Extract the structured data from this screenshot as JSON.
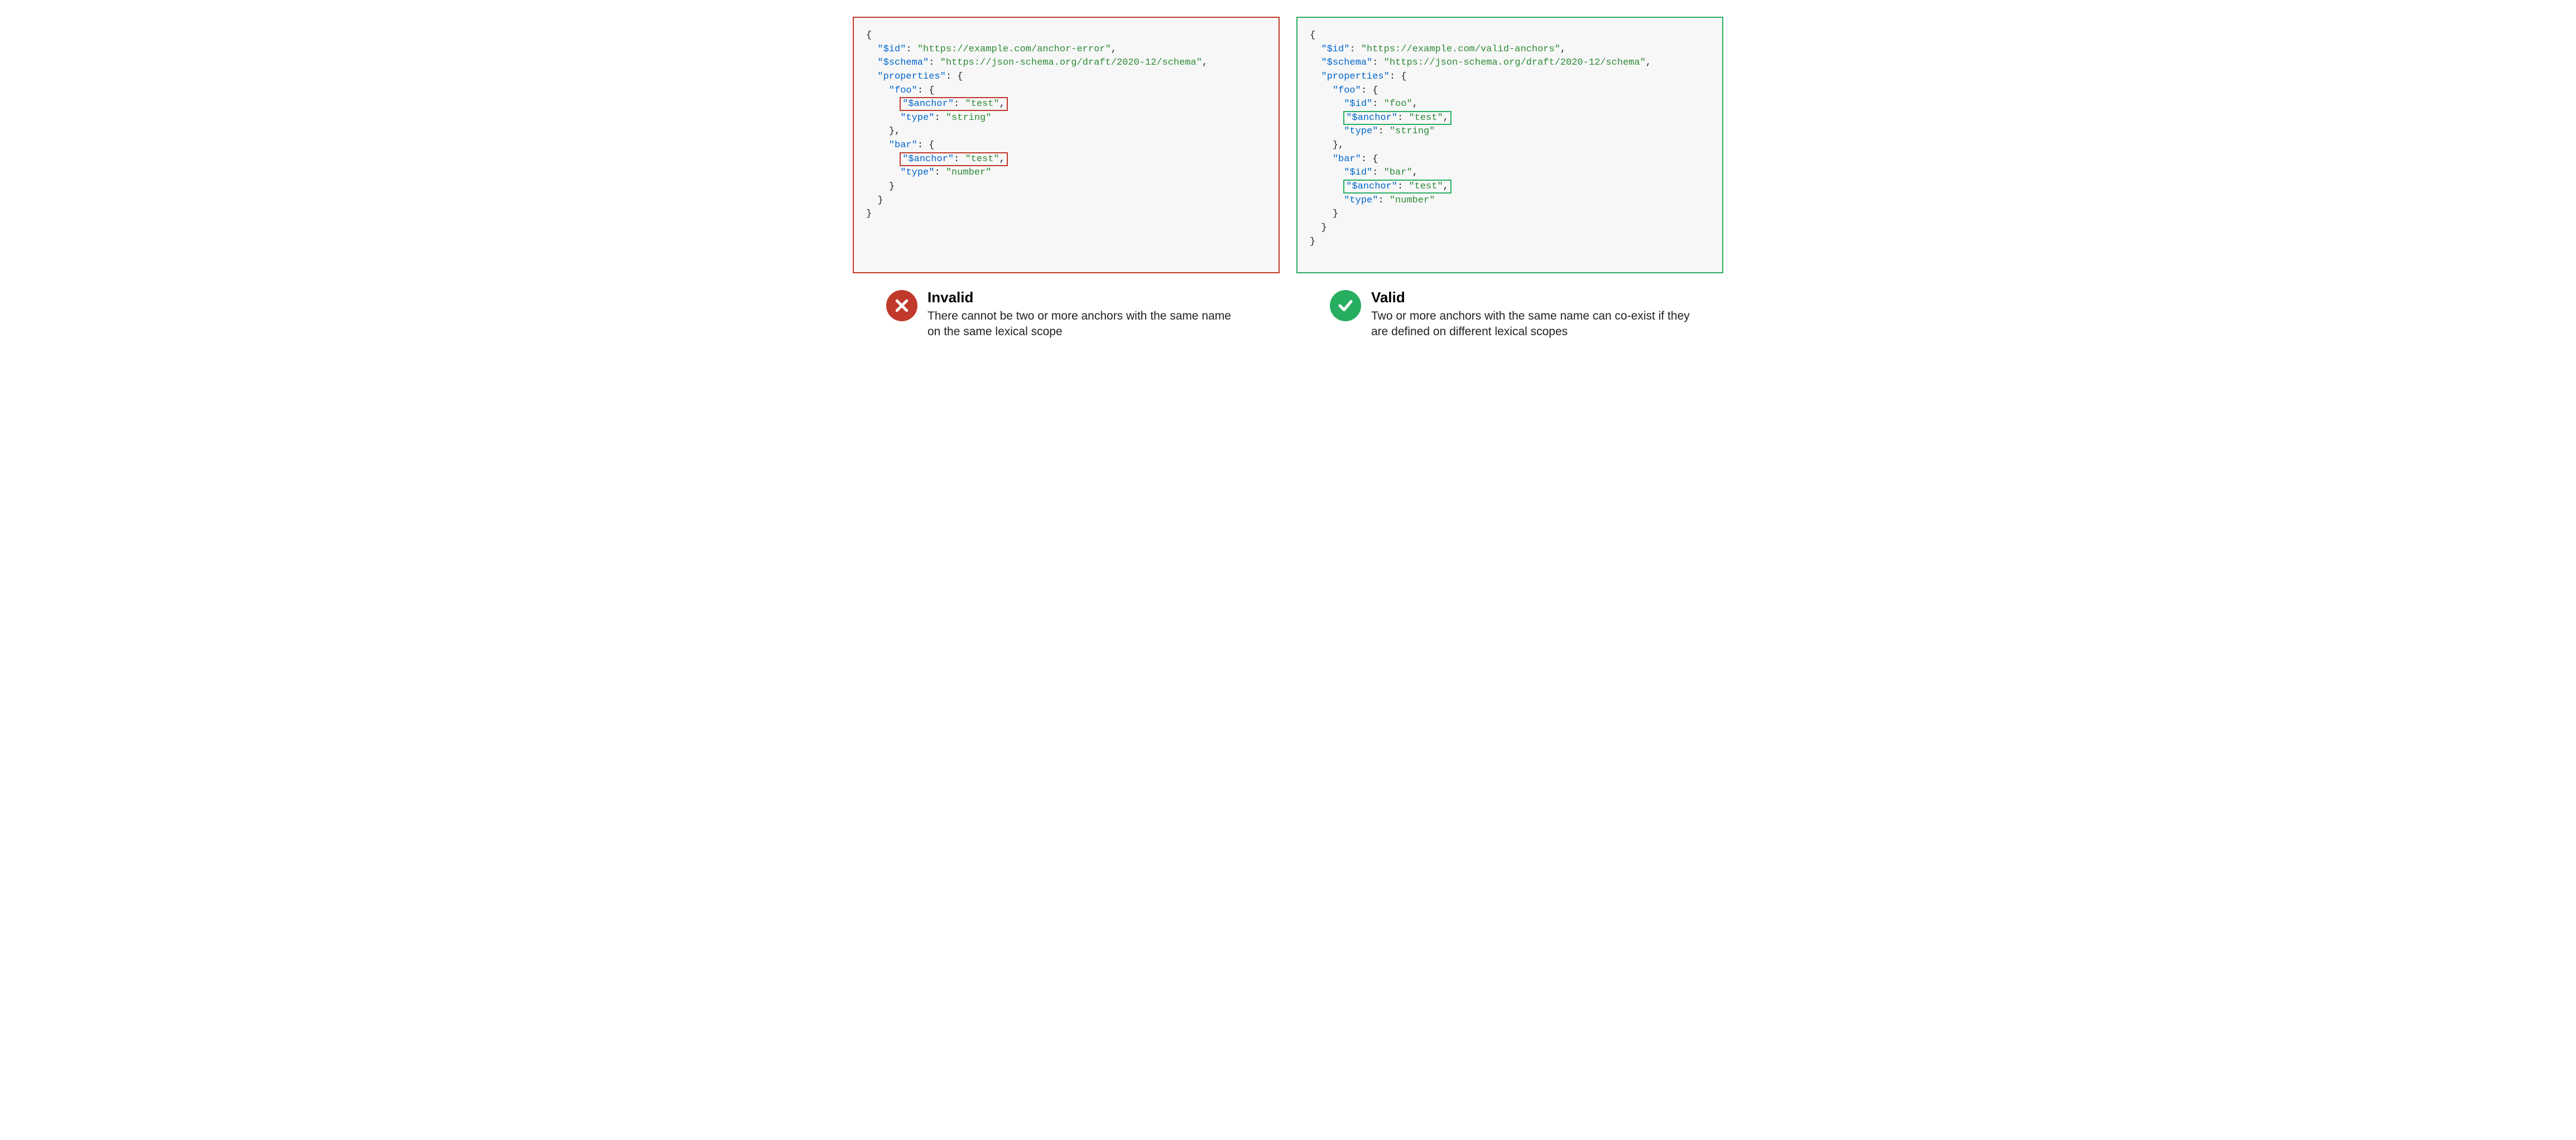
{
  "left": {
    "title": "Invalid",
    "desc": "There cannot be two or more anchors with the same name on the same lexical scope",
    "code": {
      "id_key": "\"$id\"",
      "id_val": "\"https://example.com/anchor-error\"",
      "schema_key": "\"$schema\"",
      "schema_val": "\"https://json-schema.org/draft/2020-12/schema\"",
      "props_key": "\"properties\"",
      "foo_key": "\"foo\"",
      "bar_key": "\"bar\"",
      "anchor_key": "\"$anchor\"",
      "anchor_val": "\"test\"",
      "type_key": "\"type\"",
      "type_string": "\"string\"",
      "type_number": "\"number\""
    }
  },
  "right": {
    "title": "Valid",
    "desc": "Two or more anchors with the same name can co-exist if they are defined on different lexical scopes",
    "code": {
      "id_key": "\"$id\"",
      "id_val": "\"https://example.com/valid-anchors\"",
      "schema_key": "\"$schema\"",
      "schema_val": "\"https://json-schema.org/draft/2020-12/schema\"",
      "props_key": "\"properties\"",
      "foo_key": "\"foo\"",
      "foo_id": "\"foo\"",
      "bar_key": "\"bar\"",
      "bar_id": "\"bar\"",
      "anchor_key": "\"$anchor\"",
      "anchor_val": "\"test\"",
      "type_key": "\"type\"",
      "type_string": "\"string\"",
      "type_number": "\"number\""
    }
  }
}
